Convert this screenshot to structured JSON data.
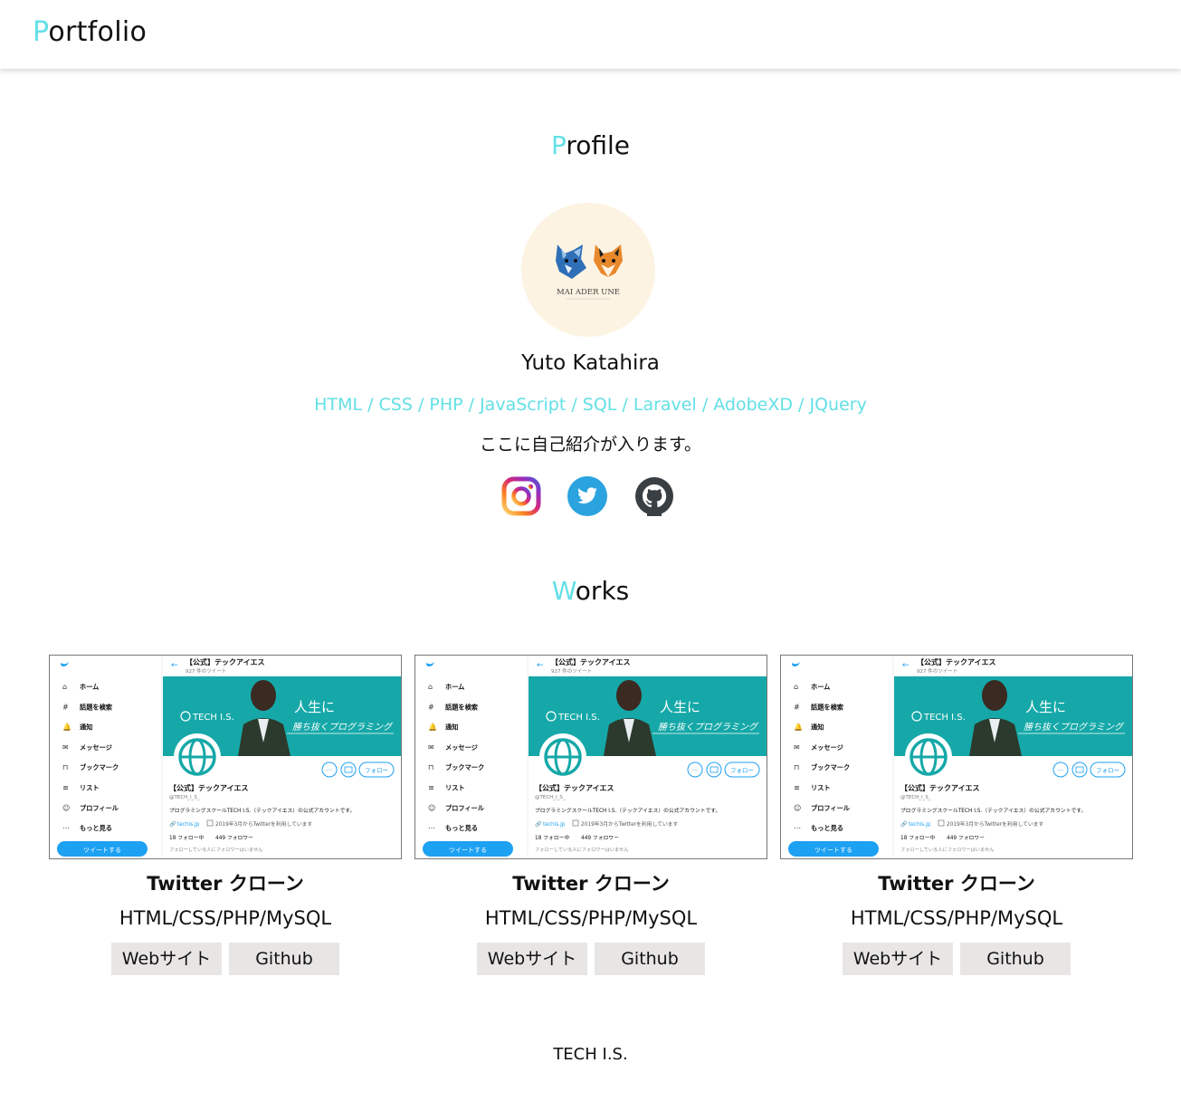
{
  "header": {
    "logo_first": "P",
    "logo_rest": "ortfolio"
  },
  "profile": {
    "title_first": "P",
    "title_rest": "rofile",
    "avatar_text": "MAI ADER UNE",
    "name": "Yuto Katahira",
    "skills": "HTML / CSS / PHP / JavaScript / SQL / Laravel / AdobeXD / JQuery",
    "intro": "ここに自己紹介が入ります。",
    "social": [
      {
        "icon": "instagram-icon"
      },
      {
        "icon": "twitter-icon",
        "color": "#1da1f2"
      },
      {
        "icon": "github-icon",
        "color": "#333333"
      }
    ]
  },
  "works": {
    "title_first": "W",
    "title_rest": "orks",
    "thumbnail": {
      "account_name": "【公式】テックアイエス",
      "tweet_count": "927 件のツイート",
      "nav": [
        "ホーム",
        "話題を検索",
        "通知",
        "メッセージ",
        "ブックマーク",
        "リスト",
        "プロフィール",
        "もっと見る"
      ],
      "tweet_button": "ツイートする",
      "banner_logo": "TECH I.S.",
      "banner_line1": "人生に",
      "banner_line2": "勝ち抜くプログラミング",
      "follow_button": "フォロー",
      "handle": "@TECH_I_S_",
      "bio": "プログラミングスクールTECH I.S.（テックアイエス）の公式アカウントです。",
      "link": "techis.jp",
      "joined": "2019年3月からTwitterを利用しています",
      "following": "18 フォロー中",
      "followers": "449 フォロワー",
      "note": "フォローしている人にフォロワーはいません"
    },
    "items": [
      {
        "title": "Twitter クローン",
        "tech": "HTML/CSS/PHP/MySQL",
        "web_label": "Webサイト",
        "github_label": "Github"
      },
      {
        "title": "Twitter クローン",
        "tech": "HTML/CSS/PHP/MySQL",
        "web_label": "Webサイト",
        "github_label": "Github"
      },
      {
        "title": "Twitter クローン",
        "tech": "HTML/CSS/PHP/MySQL",
        "web_label": "Webサイト",
        "github_label": "Github"
      }
    ]
  },
  "footer": {
    "text": "TECH I.S."
  },
  "colors": {
    "accent": "#63e0e6",
    "button_bg": "#e8e5e5",
    "twitter_teal": "#16a8a8"
  }
}
